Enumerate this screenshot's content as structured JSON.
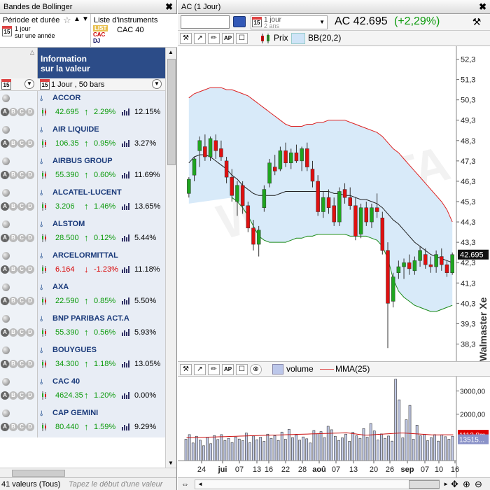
{
  "left_panel": {
    "title": "Bandes de Bollinger",
    "close_glyph": "✖",
    "period_label": "Période et durée",
    "period_cal_glyph": "15",
    "period_value_line1": "1 jour",
    "period_value_line2": "sur une année",
    "list_label": "Liste d'instruments",
    "list_icon": [
      "LIST",
      "CAC",
      "DJ"
    ],
    "list_value": "CAC 40",
    "column_title_line1": "Information",
    "column_title_line2": "sur la valeur",
    "bars_label": "1 Jour , 50 bars",
    "bars_cal_glyph": "15",
    "status_count": "41 valeurs (Tous)",
    "status_hint": "Tapez le début d'une valeur"
  },
  "stocks": [
    {
      "name": "ACCOR",
      "price": "42.695",
      "change": "2.29%",
      "dir": "up",
      "vol": "12.15%"
    },
    {
      "name": "AIR LIQUIDE",
      "price": "106.35",
      "change": "0.95%",
      "dir": "up",
      "vol": "3.27%"
    },
    {
      "name": "AIRBUS GROUP",
      "price": "55.390",
      "change": "0.60%",
      "dir": "up",
      "vol": "11.69%"
    },
    {
      "name": "ALCATEL-LUCENT",
      "price": "3.206",
      "change": "1.46%",
      "dir": "up",
      "vol": "13.65%"
    },
    {
      "name": "ALSTOM",
      "price": "28.500",
      "change": "0.12%",
      "dir": "up",
      "vol": "5.44%"
    },
    {
      "name": "ARCELORMITTAL",
      "price": "6.164",
      "change": "-1.23%",
      "dir": "down",
      "vol": "11.18%"
    },
    {
      "name": "AXA",
      "price": "22.590",
      "change": "0.85%",
      "dir": "up",
      "vol": "5.50%"
    },
    {
      "name": "BNP PARIBAS ACT.A",
      "price": "55.390",
      "change": "0.56%",
      "dir": "up",
      "vol": "5.93%"
    },
    {
      "name": "BOUYGUES",
      "price": "34.300",
      "change": "1.18%",
      "dir": "up",
      "vol": "13.05%"
    },
    {
      "name": "CAC 40",
      "price": "4624.35",
      "change": "1.20%",
      "dir": "up",
      "vol": "0.00%"
    },
    {
      "name": "CAP GEMINI",
      "price": "80.440",
      "change": "1.59%",
      "dir": "up",
      "vol": "9.29%"
    }
  ],
  "right_panel": {
    "title": "AC (1 Jour)",
    "close_glyph": "✖",
    "period_line1": "1 jour",
    "period_line2": "2 ans",
    "period_cal_glyph": "15",
    "symbol": "AC 42.695",
    "change": "(+2,29%)",
    "tools_glyph": "⚒",
    "legend_price": "Prix",
    "legend_bb": "BB(20,2)",
    "legend_volume": "volume",
    "legend_mma": "MMA(25)",
    "watermark": "Walmaster Xe",
    "bg_watermark": "WALDATA",
    "toolbar_glyphs": [
      "⚒",
      "↗",
      "✏",
      "AP",
      "☐",
      "⊗"
    ],
    "scroll_glyphs": [
      "◄",
      "►"
    ],
    "nav_glyphs": [
      "✥",
      "⊕",
      "⊖"
    ],
    "link_glyph": "⇔"
  },
  "chart_data": [
    {
      "type": "candlestick",
      "title": "AC (1 Jour)",
      "indicator": "BB(20,2)",
      "y_ticks": [
        "52,3",
        "51,3",
        "50,3",
        "49,3",
        "48,3",
        "47,3",
        "46,3",
        "45,3",
        "44,3",
        "43,3",
        "42,3",
        "41,3",
        "40,3",
        "39,3",
        "38,3"
      ],
      "ylim": [
        37.8,
        52.8
      ],
      "last_price_label": "42.695",
      "x_ticks": [
        "24",
        "jui",
        "07",
        "13",
        "16",
        "22",
        "28",
        "aoû",
        "07",
        "13",
        "20",
        "26",
        "sep",
        "07",
        "10",
        "16"
      ],
      "candles_ohlc": [
        [
          45.7,
          46.5,
          45.5,
          46.4
        ],
        [
          46.6,
          47.5,
          46.3,
          47.4
        ],
        [
          47.8,
          48.5,
          47.0,
          48.3
        ],
        [
          48.0,
          48.6,
          47.3,
          47.5
        ],
        [
          47.5,
          48.5,
          47.3,
          48.4
        ],
        [
          48.3,
          48.6,
          47.4,
          47.8
        ],
        [
          47.9,
          48.3,
          47.3,
          47.5
        ],
        [
          47.3,
          47.5,
          46.2,
          46.5
        ],
        [
          46.5,
          46.9,
          45.3,
          45.6
        ],
        [
          45.3,
          46.3,
          44.6,
          46.1
        ],
        [
          46.1,
          46.3,
          44.7,
          45.1
        ],
        [
          45.1,
          45.3,
          43.8,
          44.0
        ],
        [
          44.0,
          44.4,
          42.9,
          43.2
        ],
        [
          43.2,
          44.1,
          42.6,
          43.9
        ],
        [
          45.0,
          46.1,
          44.8,
          45.9
        ],
        [
          46.2,
          47.4,
          46.0,
          47.2
        ],
        [
          47.0,
          47.6,
          46.6,
          46.8
        ],
        [
          46.9,
          48.0,
          46.8,
          47.8
        ],
        [
          47.8,
          48.2,
          47.0,
          47.2
        ],
        [
          47.2,
          47.9,
          46.9,
          47.7
        ],
        [
          47.7,
          48.1,
          47.2,
          47.3
        ],
        [
          47.3,
          48.0,
          46.8,
          47.9
        ],
        [
          47.9,
          48.2,
          46.8,
          47.0
        ],
        [
          46.9,
          47.3,
          46.0,
          46.3
        ],
        [
          46.3,
          46.6,
          44.6,
          44.8
        ],
        [
          44.8,
          45.8,
          44.5,
          45.5
        ],
        [
          45.5,
          45.9,
          44.7,
          45.0
        ],
        [
          45.1,
          45.5,
          44.1,
          44.3
        ],
        [
          44.3,
          46.0,
          44.1,
          45.8
        ],
        [
          45.9,
          46.2,
          45.2,
          45.5
        ],
        [
          45.5,
          46.0,
          44.9,
          45.1
        ],
        [
          45.1,
          45.5,
          43.4,
          43.6
        ],
        [
          43.7,
          45.2,
          43.5,
          45.0
        ],
        [
          45.0,
          45.3,
          44.1,
          44.3
        ],
        [
          44.3,
          45.2,
          44.0,
          45.0
        ],
        [
          45.0,
          45.7,
          44.5,
          44.8
        ],
        [
          44.5,
          44.8,
          42.7,
          42.9
        ],
        [
          42.9,
          43.3,
          38.1,
          40.3
        ],
        [
          40.4,
          41.8,
          40.1,
          41.6
        ],
        [
          41.8,
          42.4,
          41.5,
          42.1
        ],
        [
          42.1,
          42.5,
          41.5,
          42.3
        ],
        [
          42.3,
          42.7,
          41.7,
          42.0
        ],
        [
          41.9,
          42.6,
          41.7,
          42.4
        ],
        [
          42.4,
          43.1,
          42.1,
          42.9
        ],
        [
          42.7,
          43.0,
          42.0,
          42.2
        ],
        [
          42.2,
          42.6,
          41.8,
          42.1
        ],
        [
          42.1,
          42.9,
          41.8,
          42.7
        ],
        [
          42.6,
          43.0,
          41.9,
          42.2
        ],
        [
          42.2,
          42.4,
          41.6,
          41.8
        ],
        [
          41.8,
          42.8,
          41.7,
          42.695
        ]
      ],
      "bb_upper": [
        50.4,
        50.6,
        50.7,
        50.8,
        50.9,
        50.9,
        50.9,
        50.8,
        50.8,
        50.7,
        50.6,
        50.5,
        50.3,
        50.1,
        49.9,
        49.7,
        49.5,
        49.3,
        49.1,
        49.0,
        49.0,
        49.0,
        49.1,
        49.1,
        49.2,
        49.2,
        49.3,
        49.3,
        49.3,
        49.3,
        49.2,
        49.1,
        49.0,
        48.9,
        48.8,
        48.7,
        48.5,
        48.2,
        47.9,
        47.7,
        47.4,
        47.1,
        46.8,
        46.5,
        46.2,
        45.9,
        45.6,
        45.3,
        44.9,
        44.3
      ],
      "bb_middle": [
        47.2,
        47.5,
        47.6,
        47.6,
        47.5,
        47.3,
        47.1,
        46.9,
        46.6,
        46.4,
        46.1,
        45.9,
        45.7,
        45.6,
        45.6,
        45.6,
        45.6,
        45.7,
        45.8,
        45.8,
        45.8,
        45.8,
        45.8,
        45.8,
        45.8,
        45.8,
        45.8,
        45.7,
        45.7,
        45.6,
        45.6,
        45.5,
        45.4,
        45.4,
        45.3,
        45.2,
        45.0,
        44.7,
        44.4,
        44.2,
        43.9,
        43.6,
        43.3,
        43.1,
        42.9,
        42.7,
        42.6,
        42.5,
        42.4,
        42.3
      ],
      "bb_lower": [
        45.5,
        45.3,
        45.0,
        44.6,
        44.1,
        43.6,
        43.4,
        43.3,
        43.3,
        43.3,
        43.3,
        43.4,
        43.5,
        43.5,
        43.6,
        43.6,
        43.7,
        43.7,
        43.7,
        43.7,
        43.7,
        43.7,
        43.6,
        43.6,
        43.6,
        43.6,
        43.5,
        43.4,
        43.1,
        42.5,
        41.5,
        40.9,
        40.6,
        40.4,
        40.2,
        40.1,
        40.0,
        39.9,
        39.9,
        40.0,
        40.1,
        40.2
      ]
    },
    {
      "type": "bar",
      "title": "volume",
      "indicator": "MMA(25)",
      "y_ticks": [
        "3000,00",
        "2000,00"
      ],
      "ylim": [
        0,
        3500
      ],
      "last_mma_label": "1112.8m",
      "last_volume_label": "13515...",
      "values": [
        920,
        1120,
        760,
        1050,
        880,
        640,
        1000,
        730,
        1080,
        910,
        1120,
        870,
        960,
        780,
        1020,
        930,
        860,
        1190,
        770,
        1060,
        900,
        1010,
        830,
        1140,
        960,
        1080,
        870,
        1230,
        920,
        1350,
        990,
        1110,
        880,
        1020,
        940,
        760,
        1300,
        1160,
        1250,
        990,
        1480,
        1330,
        1050,
        870,
        980,
        1140,
        830,
        1220,
        1070,
        960,
        1380,
        1010,
        1600,
        1280,
        890,
        1150,
        960,
        1060,
        840,
        3510,
        2620,
        980,
        1760,
        2380,
        920,
        1530,
        1070,
        1130,
        860,
        990,
        1120,
        840,
        1110,
        1030,
        920,
        1050
      ],
      "mma": [
        980,
        985,
        990,
        995,
        1000,
        1005,
        1010,
        1015,
        1020,
        1025,
        1030,
        1035,
        1040,
        1045,
        1050,
        1055,
        1060,
        1065,
        1070,
        1075,
        1080,
        1085,
        1090,
        1095,
        1100,
        1100,
        1105,
        1110,
        1115,
        1120,
        1125,
        1130,
        1135,
        1140,
        1145,
        1150,
        1155,
        1160,
        1165,
        1170,
        1175,
        1180,
        1185,
        1190,
        1195,
        1200,
        1180,
        1160,
        1140,
        1120,
        1100,
        1100,
        1110,
        1120,
        1130,
        1140,
        1150,
        1160,
        1170,
        1180,
        1190,
        1190,
        1180,
        1170,
        1160,
        1150,
        1140,
        1130,
        1120,
        1110,
        1110,
        1110,
        1112,
        1112,
        1112,
        1112.8
      ]
    }
  ]
}
